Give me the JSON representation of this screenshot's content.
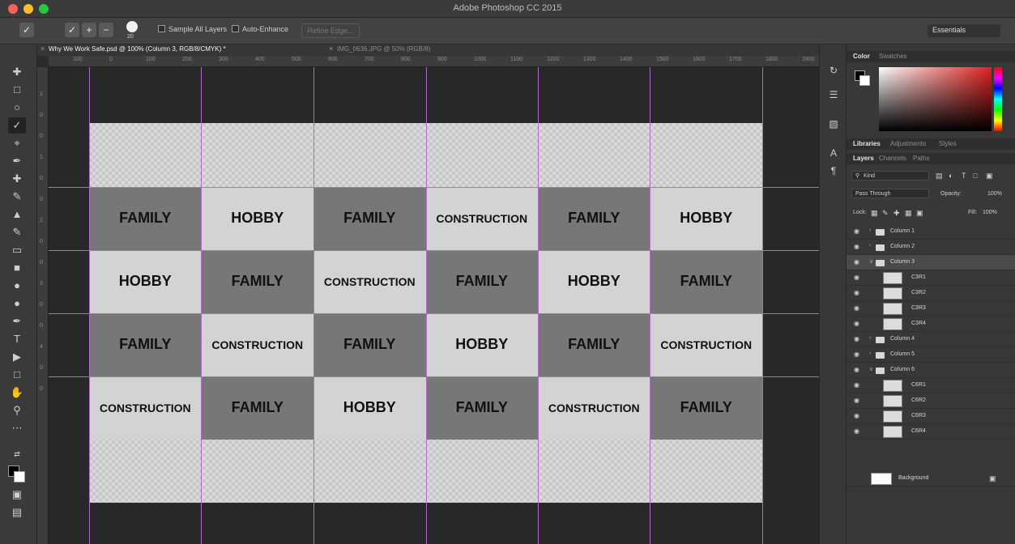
{
  "app": {
    "title": "Adobe Photoshop CC 2015"
  },
  "options_bar": {
    "brush_size": "20",
    "sample_all_layers": "Sample All Layers",
    "auto_enhance": "Auto-Enhance",
    "refine_edge": "Refine Edge...",
    "workspace": "Essentials"
  },
  "tabs": {
    "active": "Why We Work Safe.psd @ 100% (Column 3, RGB/8/CMYK) *",
    "inactive": "IMG_0636.JPG @ 50% (RGB/8)"
  },
  "rulers": {
    "horizontal": [
      "100",
      "0",
      "100",
      "200",
      "300",
      "400",
      "500",
      "600",
      "700",
      "800",
      "900",
      "1000",
      "1100",
      "1200",
      "1300",
      "1400",
      "1500",
      "1600",
      "1700",
      "1800",
      "1900",
      "200"
    ],
    "vertical": [
      "1",
      "0",
      "0",
      "1",
      "0",
      "0",
      "2",
      "0",
      "0",
      "3",
      "0",
      "0",
      "4",
      "0",
      "0"
    ]
  },
  "grid": {
    "rows": [
      [
        "FAMILY",
        "HOBBY",
        "FAMILY",
        "CONSTRUCTION",
        "FAMILY",
        "HOBBY"
      ],
      [
        "HOBBY",
        "FAMILY",
        "CONSTRUCTION",
        "FAMILY",
        "HOBBY",
        "FAMILY"
      ],
      [
        "FAMILY",
        "CONSTRUCTION",
        "FAMILY",
        "HOBBY",
        "FAMILY",
        "CONSTRUCTION"
      ],
      [
        "CONSTRUCTION",
        "FAMILY",
        "HOBBY",
        "FAMILY",
        "CONSTRUCTION",
        "FAMILY"
      ]
    ],
    "shade": [
      [
        "dark",
        "light",
        "dark",
        "light",
        "dark",
        "light"
      ],
      [
        "light",
        "dark",
        "light",
        "dark",
        "light",
        "dark"
      ],
      [
        "dark",
        "light",
        "dark",
        "light",
        "dark",
        "light"
      ],
      [
        "light",
        "dark",
        "light",
        "dark",
        "light",
        "dark"
      ]
    ],
    "colors": {
      "dark": "#777777",
      "light": "#d3d3d3",
      "text": "#111111",
      "guide": "#b36bc9"
    }
  },
  "color_panel": {
    "tabs": [
      "Color",
      "Swatches"
    ],
    "foreground": "#000000",
    "background": "#ffffff"
  },
  "library_tabs": [
    "Libraries",
    "Adjustments",
    "Styles"
  ],
  "layers_panel": {
    "tabs": [
      "Layers",
      "Channels",
      "Paths"
    ],
    "kind_filter": "Kind",
    "blend_mode": "Pass Through",
    "opacity_label": "Opacity:",
    "opacity_value": "100%",
    "lock_label": "Lock:",
    "fill_label": "Fill:",
    "fill_value": "100%",
    "layers": [
      {
        "name": "Column 1",
        "type": "group",
        "expanded": false,
        "selected": false
      },
      {
        "name": "Column 2",
        "type": "group",
        "expanded": false,
        "selected": false
      },
      {
        "name": "Column 3",
        "type": "group",
        "expanded": true,
        "selected": true
      },
      {
        "name": "C3R1",
        "type": "layer",
        "selected": false
      },
      {
        "name": "C3R2",
        "type": "layer",
        "selected": false
      },
      {
        "name": "C3R3",
        "type": "layer",
        "selected": false
      },
      {
        "name": "C3R4",
        "type": "layer",
        "selected": false
      },
      {
        "name": "Column 4",
        "type": "group",
        "expanded": false,
        "selected": false
      },
      {
        "name": "Column 5",
        "type": "group",
        "expanded": false,
        "selected": false
      },
      {
        "name": "Column 6",
        "type": "group",
        "expanded": true,
        "selected": false
      },
      {
        "name": "C6R1",
        "type": "layer",
        "selected": false
      },
      {
        "name": "C6R2",
        "type": "layer",
        "selected": false
      },
      {
        "name": "C6R3",
        "type": "layer",
        "selected": false
      },
      {
        "name": "C6R4",
        "type": "layer",
        "selected": false
      }
    ],
    "background_layer": "Background"
  }
}
